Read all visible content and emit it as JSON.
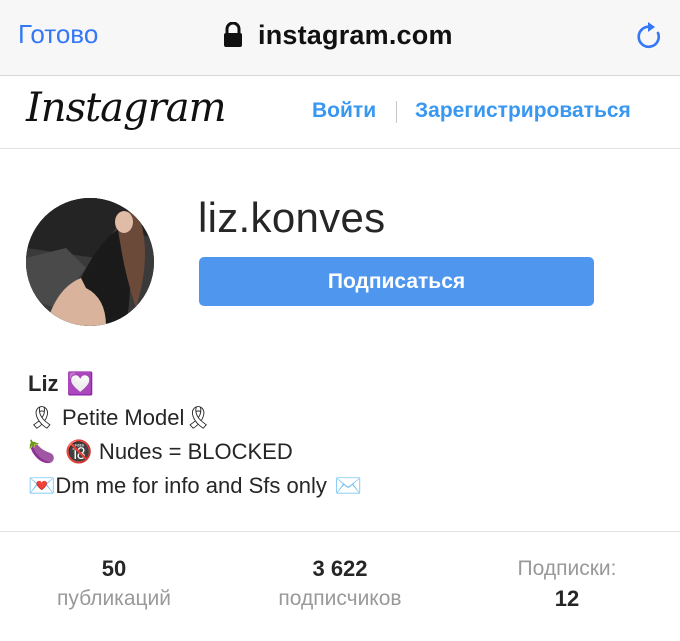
{
  "browser": {
    "done_label": "Готово",
    "url": "instagram.com",
    "lock_icon": "lock-icon",
    "reload_icon": "reload-icon",
    "accent": "#3478f6"
  },
  "header": {
    "logo": "Instagram",
    "login_label": "Войти",
    "separator": "|",
    "signup_label": "Зарегистрироваться",
    "link_color": "#3897f0"
  },
  "profile": {
    "username": "liz.konves",
    "follow_label": "Подписаться",
    "button_color": "#4f97ee",
    "bio": {
      "name": "Liz",
      "name_emoji": "💟",
      "line2_pre": "🎗",
      "line2_text": " Petite Model",
      "line2_post": "🎗",
      "line3_pre": "🍆",
      "line3_mid": "🔞",
      "line3_text": " Nudes = BLOCKED",
      "line4_pre": "💌",
      "line4_text": "Dm me for info and Sfs only",
      "line4_post": "✉️"
    }
  },
  "stats": {
    "posts_count": "50",
    "posts_label": "публикаций",
    "followers_count": "3 622",
    "followers_label": "подписчиков",
    "following_label": "Подписки:",
    "following_count": "12"
  }
}
